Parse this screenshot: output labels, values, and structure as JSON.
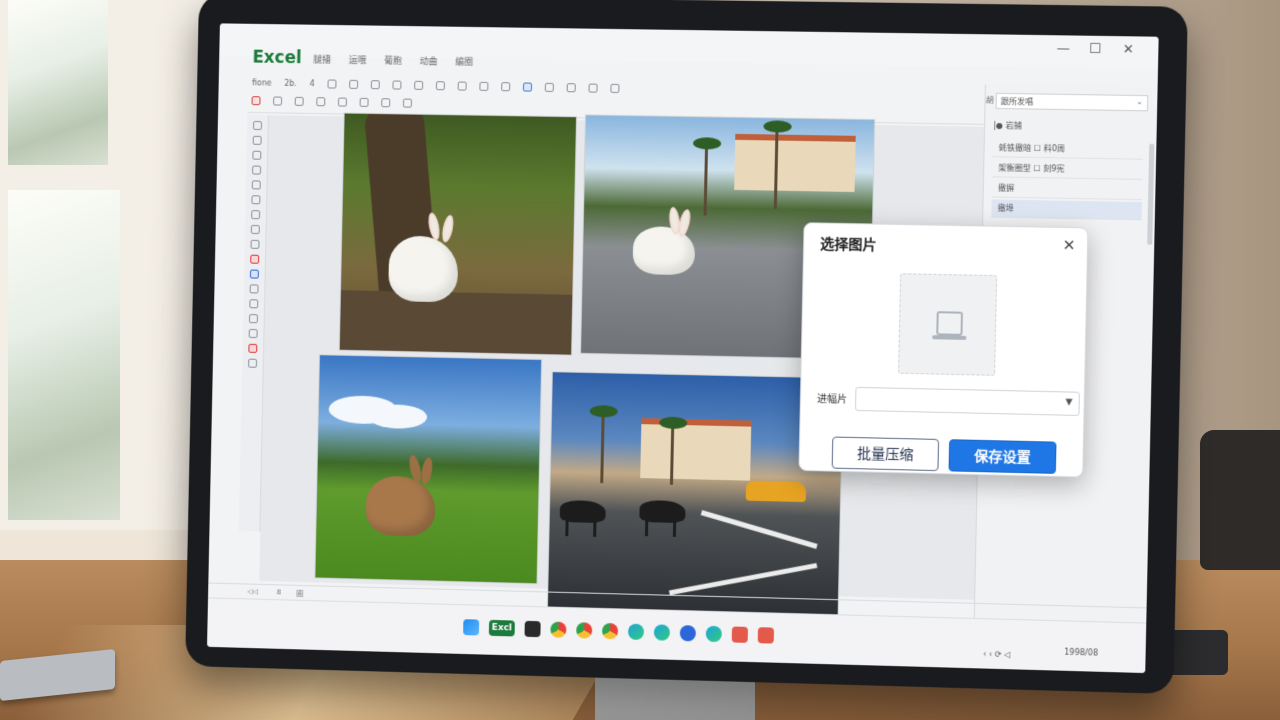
{
  "app": {
    "name": "Excel",
    "menu": [
      "腿播",
      "运哦",
      "葡胞",
      "动曲",
      "编圈"
    ]
  },
  "toolbar": {
    "row1_labels": [
      "fione",
      "2b.",
      "4"
    ],
    "row2_labels": []
  },
  "right_panel": {
    "header_label": "胡",
    "select_value": "跟所发唱",
    "section_label": "|● 岩捕",
    "items": [
      {
        "label": "蚝铁撤暗 ☐ 料0周"
      },
      {
        "label": "架衡圈型 ☐ 刻9宪"
      },
      {
        "label": "撤摒"
      },
      {
        "label": "撤埠"
      }
    ]
  },
  "dialog": {
    "title": "选择图片",
    "close_symbol": "✕",
    "field_label": "进幅片",
    "field_value": "",
    "batch_button": "批量压缩",
    "save_button": "保存设置"
  },
  "status": {
    "tabs": [
      "◁◁",
      "8",
      "圈"
    ]
  },
  "taskbar": {
    "excel_label": "Excl",
    "tray_text": "‹  ‹  ⟳  ◁",
    "clock_text": "1998/08"
  },
  "colors": {
    "accent": "#1f77e5",
    "excel_green": "#1b7a3c"
  }
}
